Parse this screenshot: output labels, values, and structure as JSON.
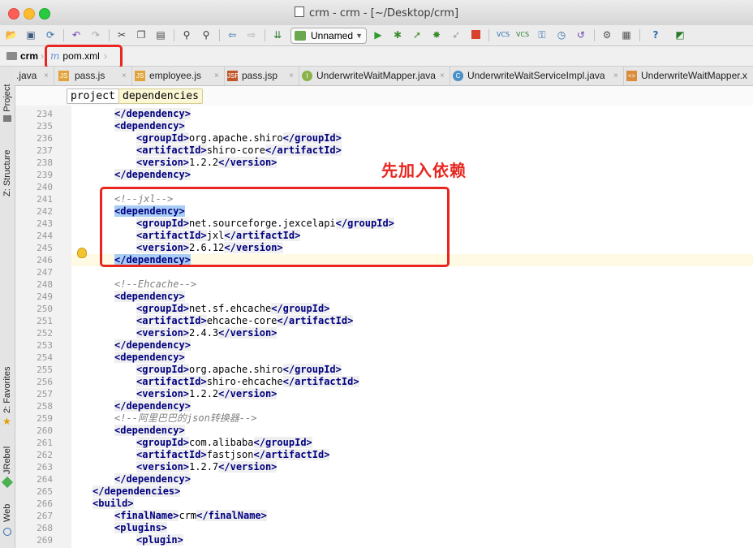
{
  "window": {
    "title": "crm - crm - [~/Desktop/crm]"
  },
  "toolbar": {
    "run_config": "Unnamed"
  },
  "navbar": {
    "project": "crm",
    "file": "pom.xml"
  },
  "tabs": [
    {
      "label": ".java",
      "icon": "java-file-icon"
    },
    {
      "label": "pass.js",
      "icon": "js-file-icon"
    },
    {
      "label": "employee.js",
      "icon": "js-file-icon"
    },
    {
      "label": "pass.jsp",
      "icon": "jsp-file-icon"
    },
    {
      "label": "UnderwriteWaitMapper.java",
      "icon": "interface-icon"
    },
    {
      "label": "UnderwriteWaitServiceImpl.java",
      "icon": "class-icon"
    },
    {
      "label": "UnderwriteWaitMapper.x",
      "icon": "xml-file-icon"
    }
  ],
  "breadcrumb": {
    "items": [
      "project",
      "dependencies"
    ]
  },
  "side_panels": {
    "project": "1: Project",
    "structure": "Z: Structure",
    "favorites": "2: Favorites",
    "jrebel": "JRebel",
    "web": "Web"
  },
  "annotation": {
    "text": "先加入依赖"
  },
  "code": [
    {
      "n": "234",
      "indent": 1,
      "parts": [
        [
          "tag",
          "</dependency>"
        ]
      ]
    },
    {
      "n": "235",
      "indent": 1,
      "parts": [
        [
          "tag",
          "<dependency>"
        ]
      ]
    },
    {
      "n": "236",
      "indent": 2,
      "parts": [
        [
          "tag",
          "<groupId>"
        ],
        [
          "text",
          "org.apache.shiro"
        ],
        [
          "tag",
          "</groupId>"
        ]
      ]
    },
    {
      "n": "237",
      "indent": 2,
      "parts": [
        [
          "tag",
          "<artifactId>"
        ],
        [
          "text",
          "shiro-core"
        ],
        [
          "tag",
          "</artifactId>"
        ]
      ]
    },
    {
      "n": "238",
      "indent": 2,
      "parts": [
        [
          "tag",
          "<version>"
        ],
        [
          "text",
          "1.2.2"
        ],
        [
          "tag",
          "</version>"
        ]
      ]
    },
    {
      "n": "239",
      "indent": 1,
      "parts": [
        [
          "tag",
          "</dependency>"
        ]
      ]
    },
    {
      "n": "240",
      "indent": 0,
      "parts": []
    },
    {
      "n": "241",
      "indent": 1,
      "parts": [
        [
          "comment",
          "<!--jxl-->"
        ]
      ]
    },
    {
      "n": "242",
      "indent": 1,
      "parts": [
        [
          "taghl",
          "<dependency>"
        ]
      ]
    },
    {
      "n": "243",
      "indent": 2,
      "parts": [
        [
          "tag",
          "<groupId>"
        ],
        [
          "text",
          "net.sourceforge.jexcelapi"
        ],
        [
          "tag",
          "</groupId>"
        ]
      ]
    },
    {
      "n": "244",
      "indent": 2,
      "parts": [
        [
          "tag",
          "<artifactId>"
        ],
        [
          "text",
          "jxl"
        ],
        [
          "tag",
          "</artifactId>"
        ]
      ]
    },
    {
      "n": "245",
      "indent": 2,
      "parts": [
        [
          "tag",
          "<version>"
        ],
        [
          "text",
          "2.6.12"
        ],
        [
          "tag",
          "</version>"
        ]
      ]
    },
    {
      "n": "246",
      "indent": 1,
      "parts": [
        [
          "taghl",
          "</dependency>"
        ]
      ]
    },
    {
      "n": "247",
      "indent": 0,
      "parts": []
    },
    {
      "n": "248",
      "indent": 1,
      "parts": [
        [
          "comment",
          "<!--Ehcache-->"
        ]
      ]
    },
    {
      "n": "249",
      "indent": 1,
      "parts": [
        [
          "tag",
          "<dependency>"
        ]
      ]
    },
    {
      "n": "250",
      "indent": 2,
      "parts": [
        [
          "tag",
          "<groupId>"
        ],
        [
          "text",
          "net.sf.ehcache"
        ],
        [
          "tag",
          "</groupId>"
        ]
      ]
    },
    {
      "n": "251",
      "indent": 2,
      "parts": [
        [
          "tag",
          "<artifactId>"
        ],
        [
          "text",
          "ehcache-core"
        ],
        [
          "tag",
          "</artifactId>"
        ]
      ]
    },
    {
      "n": "252",
      "indent": 2,
      "parts": [
        [
          "tag",
          "<version>"
        ],
        [
          "text",
          "2.4.3"
        ],
        [
          "tag",
          "</version>"
        ]
      ]
    },
    {
      "n": "253",
      "indent": 1,
      "parts": [
        [
          "tag",
          "</dependency>"
        ]
      ]
    },
    {
      "n": "254",
      "indent": 1,
      "parts": [
        [
          "tag",
          "<dependency>"
        ]
      ]
    },
    {
      "n": "255",
      "indent": 2,
      "parts": [
        [
          "tag",
          "<groupId>"
        ],
        [
          "text",
          "org.apache.shiro"
        ],
        [
          "tag",
          "</groupId>"
        ]
      ]
    },
    {
      "n": "256",
      "indent": 2,
      "parts": [
        [
          "tag",
          "<artifactId>"
        ],
        [
          "text",
          "shiro-ehcache"
        ],
        [
          "tag",
          "</artifactId>"
        ]
      ]
    },
    {
      "n": "257",
      "indent": 2,
      "parts": [
        [
          "tag",
          "<version>"
        ],
        [
          "text",
          "1.2.2"
        ],
        [
          "tag",
          "</version>"
        ]
      ]
    },
    {
      "n": "258",
      "indent": 1,
      "parts": [
        [
          "tag",
          "</dependency>"
        ]
      ]
    },
    {
      "n": "259",
      "indent": 1,
      "parts": [
        [
          "comment",
          "<!--阿里巴巴的json转换器-->"
        ]
      ]
    },
    {
      "n": "260",
      "indent": 1,
      "parts": [
        [
          "tag",
          "<dependency>"
        ]
      ]
    },
    {
      "n": "261",
      "indent": 2,
      "parts": [
        [
          "tag",
          "<groupId>"
        ],
        [
          "text",
          "com.alibaba"
        ],
        [
          "tag",
          "</groupId>"
        ]
      ]
    },
    {
      "n": "262",
      "indent": 2,
      "parts": [
        [
          "tag",
          "<artifactId>"
        ],
        [
          "text",
          "fastjson"
        ],
        [
          "tag",
          "</artifactId>"
        ]
      ]
    },
    {
      "n": "263",
      "indent": 2,
      "parts": [
        [
          "tag",
          "<version>"
        ],
        [
          "text",
          "1.2.7"
        ],
        [
          "tag",
          "</version>"
        ]
      ]
    },
    {
      "n": "264",
      "indent": 1,
      "parts": [
        [
          "tag",
          "</dependency>"
        ]
      ]
    },
    {
      "n": "265",
      "indent": 0,
      "parts": [
        [
          "tag",
          "</dependencies>"
        ]
      ]
    },
    {
      "n": "266",
      "indent": 0,
      "parts": [
        [
          "tag",
          "<build>"
        ]
      ]
    },
    {
      "n": "267",
      "indent": 1,
      "parts": [
        [
          "tag",
          "<finalName>"
        ],
        [
          "text",
          "crm"
        ],
        [
          "tag",
          "</finalName>"
        ]
      ]
    },
    {
      "n": "268",
      "indent": 1,
      "parts": [
        [
          "tag",
          "<plugins>"
        ]
      ]
    },
    {
      "n": "269",
      "indent": 2,
      "parts": [
        [
          "tag",
          "<plugin>"
        ]
      ]
    }
  ],
  "colors": {
    "tag": "#000080",
    "comment": "#808080",
    "highlight_box": "#e8261f",
    "caret_line": "#fffae3",
    "bracket_match": "#a8cdf4"
  }
}
